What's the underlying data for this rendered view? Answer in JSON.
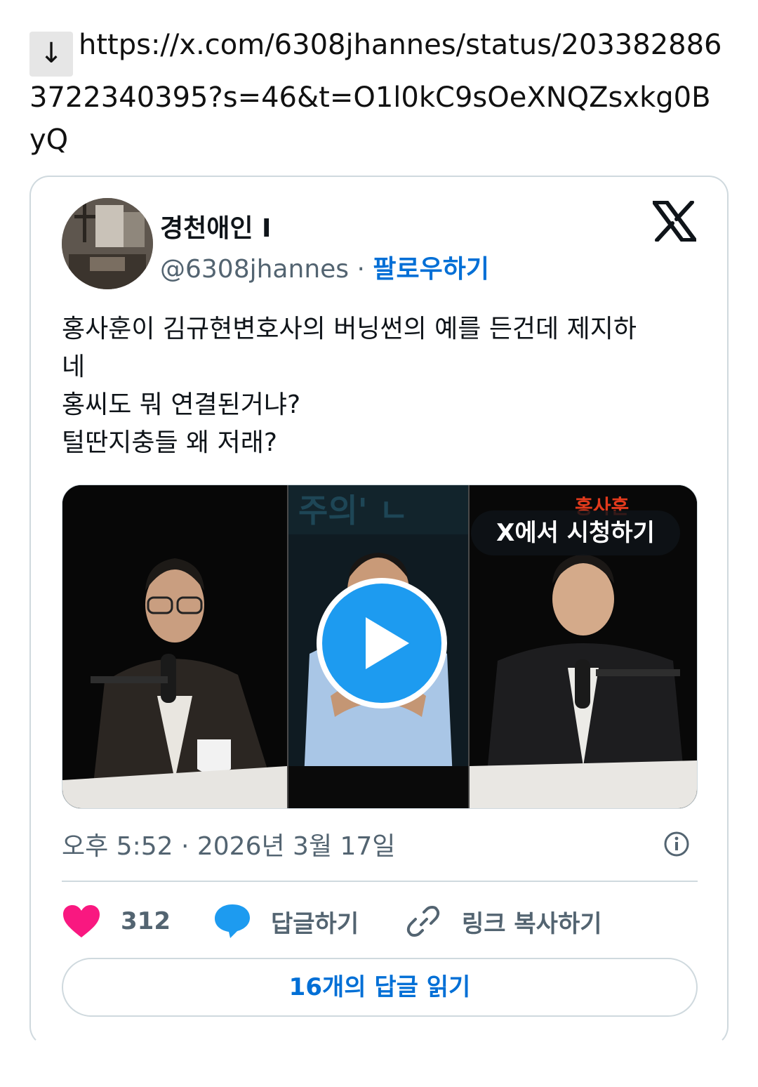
{
  "share": {
    "arrow_icon": "down-arrow-icon",
    "url": "https://x.com/6308jhannes/status/2033828863722340395?s=46&t=O1l0kC9sOeXNQZsxkg0ByQ"
  },
  "tweet": {
    "display_name": "경천애인 I",
    "handle": "@6308jhannes",
    "dot": "·",
    "follow_label": "팔로우하기",
    "text_lines": [
      "홍사훈이 김규현변호사의 버닝썬의 예를 든건데 제지하",
      "네",
      "홍씨도 뭐 연결된거냐?",
      "털딴지충들 왜 저래?"
    ],
    "media": {
      "watch_label": "X에서 시청하기",
      "play_icon": "play-icon"
    },
    "timestamp": "오후 5:52 · 2026년 3월 17일",
    "actions": {
      "like_count": "312",
      "reply_label": "답글하기",
      "copy_link_label": "링크 복사하기"
    },
    "read_replies_label": "16개의 답글 읽기"
  },
  "colors": {
    "link_blue": "#006fd6",
    "play_blue": "#1d9bf0",
    "like_pink": "#f91880",
    "reply_blue": "#1d9bf0",
    "muted_gray": "#536471",
    "border": "#cfd9de"
  }
}
